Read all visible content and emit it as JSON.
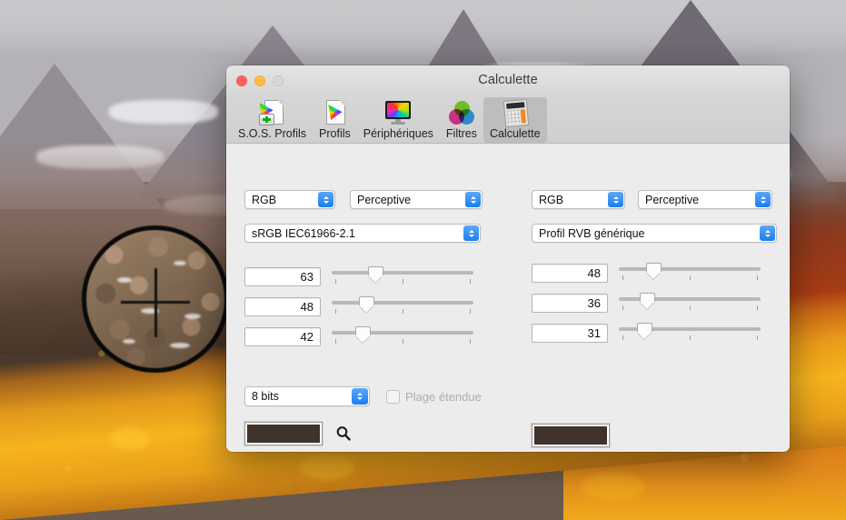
{
  "window": {
    "title": "Calculette",
    "traffic_lights": [
      "close-red",
      "minimize-yellow",
      "zoom-disabled"
    ]
  },
  "toolbar": {
    "items": [
      {
        "label": "S.O.S. Profils",
        "icon": "first-aid-profile-icon",
        "selected": false
      },
      {
        "label": "Profils",
        "icon": "profile-document-icon",
        "selected": false
      },
      {
        "label": "Périphériques",
        "icon": "display-monitor-icon",
        "selected": false
      },
      {
        "label": "Filtres",
        "icon": "rgb-circles-icon",
        "selected": false
      },
      {
        "label": "Calculette",
        "icon": "calculator-icon",
        "selected": true
      }
    ]
  },
  "left_panel": {
    "color_space": "RGB",
    "rendering_intent": "Perceptive",
    "profile": "sRGB IEC61966-2.1",
    "channels": [
      {
        "value": "63",
        "slider_percent": 25
      },
      {
        "value": "48",
        "slider_percent": 19
      },
      {
        "value": "42",
        "slider_percent": 16
      }
    ],
    "swatch_color": "#3f332b"
  },
  "right_panel": {
    "color_space": "RGB",
    "rendering_intent": "Perceptive",
    "profile": "Profil RVB générique",
    "channels": [
      {
        "value": "48",
        "slider_percent": 19
      },
      {
        "value": "36",
        "slider_percent": 14
      },
      {
        "value": "31",
        "slider_percent": 12
      }
    ],
    "swatch_color": "#3f332b"
  },
  "bottom": {
    "bit_depth": "8 bits",
    "extended_range_label": "Plage étendue",
    "extended_range_checked": false,
    "extended_range_enabled": false,
    "picker_icon": "magnifier-icon"
  },
  "desktop": {
    "wallpaper_name": "high-sierra-mountain-wallpaper",
    "loupe": {
      "name": "color-picker-loupe",
      "crosshair": true
    }
  },
  "colors": {
    "accent_blue": "#1a7ef0",
    "window_bg": "#ececec",
    "toolbar_selected": "#bdbdbd",
    "swatch_brown": "#3f332b"
  }
}
